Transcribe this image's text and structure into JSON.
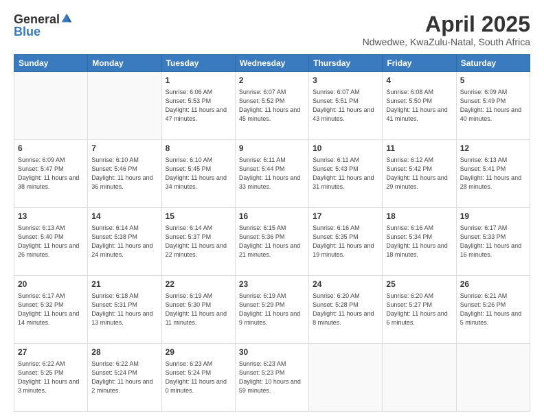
{
  "logo": {
    "general": "General",
    "blue": "Blue"
  },
  "title": "April 2025",
  "subtitle": "Ndwedwe, KwaZulu-Natal, South Africa",
  "days_of_week": [
    "Sunday",
    "Monday",
    "Tuesday",
    "Wednesday",
    "Thursday",
    "Friday",
    "Saturday"
  ],
  "weeks": [
    [
      {
        "day": "",
        "info": ""
      },
      {
        "day": "",
        "info": ""
      },
      {
        "day": "1",
        "info": "Sunrise: 6:06 AM\nSunset: 5:53 PM\nDaylight: 11 hours and 47 minutes."
      },
      {
        "day": "2",
        "info": "Sunrise: 6:07 AM\nSunset: 5:52 PM\nDaylight: 11 hours and 45 minutes."
      },
      {
        "day": "3",
        "info": "Sunrise: 6:07 AM\nSunset: 5:51 PM\nDaylight: 11 hours and 43 minutes."
      },
      {
        "day": "4",
        "info": "Sunrise: 6:08 AM\nSunset: 5:50 PM\nDaylight: 11 hours and 41 minutes."
      },
      {
        "day": "5",
        "info": "Sunrise: 6:09 AM\nSunset: 5:49 PM\nDaylight: 11 hours and 40 minutes."
      }
    ],
    [
      {
        "day": "6",
        "info": "Sunrise: 6:09 AM\nSunset: 5:47 PM\nDaylight: 11 hours and 38 minutes."
      },
      {
        "day": "7",
        "info": "Sunrise: 6:10 AM\nSunset: 5:46 PM\nDaylight: 11 hours and 36 minutes."
      },
      {
        "day": "8",
        "info": "Sunrise: 6:10 AM\nSunset: 5:45 PM\nDaylight: 11 hours and 34 minutes."
      },
      {
        "day": "9",
        "info": "Sunrise: 6:11 AM\nSunset: 5:44 PM\nDaylight: 11 hours and 33 minutes."
      },
      {
        "day": "10",
        "info": "Sunrise: 6:11 AM\nSunset: 5:43 PM\nDaylight: 11 hours and 31 minutes."
      },
      {
        "day": "11",
        "info": "Sunrise: 6:12 AM\nSunset: 5:42 PM\nDaylight: 11 hours and 29 minutes."
      },
      {
        "day": "12",
        "info": "Sunrise: 6:13 AM\nSunset: 5:41 PM\nDaylight: 11 hours and 28 minutes."
      }
    ],
    [
      {
        "day": "13",
        "info": "Sunrise: 6:13 AM\nSunset: 5:40 PM\nDaylight: 11 hours and 26 minutes."
      },
      {
        "day": "14",
        "info": "Sunrise: 6:14 AM\nSunset: 5:38 PM\nDaylight: 11 hours and 24 minutes."
      },
      {
        "day": "15",
        "info": "Sunrise: 6:14 AM\nSunset: 5:37 PM\nDaylight: 11 hours and 22 minutes."
      },
      {
        "day": "16",
        "info": "Sunrise: 6:15 AM\nSunset: 5:36 PM\nDaylight: 11 hours and 21 minutes."
      },
      {
        "day": "17",
        "info": "Sunrise: 6:16 AM\nSunset: 5:35 PM\nDaylight: 11 hours and 19 minutes."
      },
      {
        "day": "18",
        "info": "Sunrise: 6:16 AM\nSunset: 5:34 PM\nDaylight: 11 hours and 18 minutes."
      },
      {
        "day": "19",
        "info": "Sunrise: 6:17 AM\nSunset: 5:33 PM\nDaylight: 11 hours and 16 minutes."
      }
    ],
    [
      {
        "day": "20",
        "info": "Sunrise: 6:17 AM\nSunset: 5:32 PM\nDaylight: 11 hours and 14 minutes."
      },
      {
        "day": "21",
        "info": "Sunrise: 6:18 AM\nSunset: 5:31 PM\nDaylight: 11 hours and 13 minutes."
      },
      {
        "day": "22",
        "info": "Sunrise: 6:19 AM\nSunset: 5:30 PM\nDaylight: 11 hours and 11 minutes."
      },
      {
        "day": "23",
        "info": "Sunrise: 6:19 AM\nSunset: 5:29 PM\nDaylight: 11 hours and 9 minutes."
      },
      {
        "day": "24",
        "info": "Sunrise: 6:20 AM\nSunset: 5:28 PM\nDaylight: 11 hours and 8 minutes."
      },
      {
        "day": "25",
        "info": "Sunrise: 6:20 AM\nSunset: 5:27 PM\nDaylight: 11 hours and 6 minutes."
      },
      {
        "day": "26",
        "info": "Sunrise: 6:21 AM\nSunset: 5:26 PM\nDaylight: 11 hours and 5 minutes."
      }
    ],
    [
      {
        "day": "27",
        "info": "Sunrise: 6:22 AM\nSunset: 5:25 PM\nDaylight: 11 hours and 3 minutes."
      },
      {
        "day": "28",
        "info": "Sunrise: 6:22 AM\nSunset: 5:24 PM\nDaylight: 11 hours and 2 minutes."
      },
      {
        "day": "29",
        "info": "Sunrise: 6:23 AM\nSunset: 5:24 PM\nDaylight: 11 hours and 0 minutes."
      },
      {
        "day": "30",
        "info": "Sunrise: 6:23 AM\nSunset: 5:23 PM\nDaylight: 10 hours and 59 minutes."
      },
      {
        "day": "",
        "info": ""
      },
      {
        "day": "",
        "info": ""
      },
      {
        "day": "",
        "info": ""
      }
    ]
  ]
}
